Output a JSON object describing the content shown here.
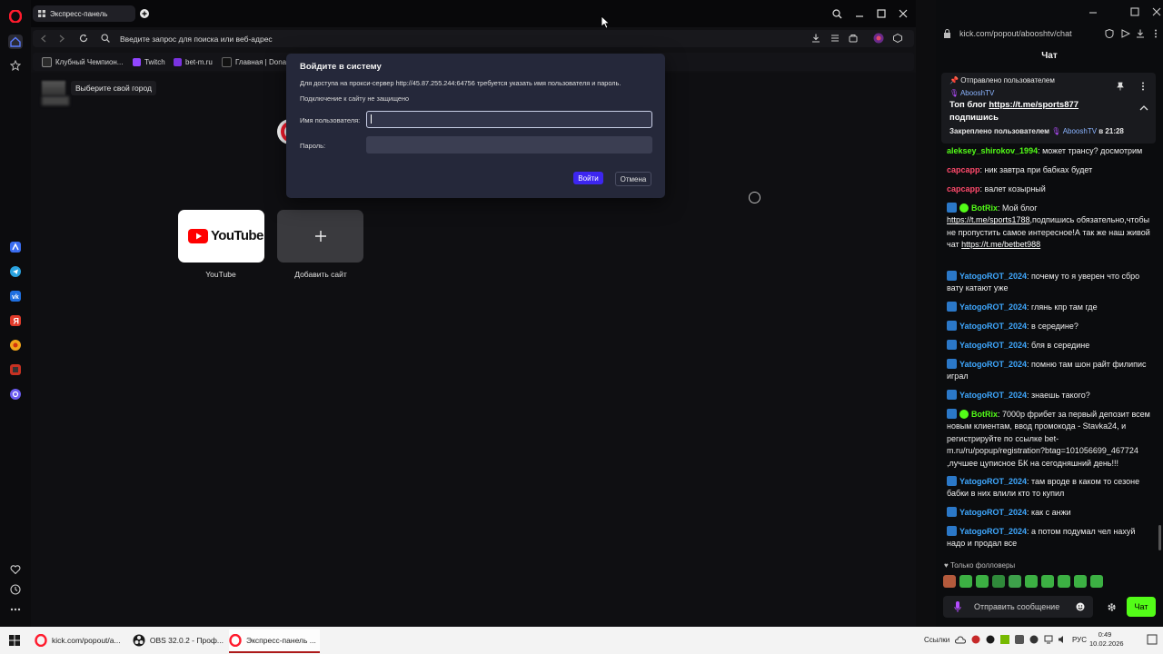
{
  "opera": {
    "tab_title": "Экспресс-панель",
    "address_placeholder": "Введите запрос для поиска или веб-адрес",
    "bookmarks": [
      {
        "label": "Клубный Чемпион..."
      },
      {
        "label": "Twitch"
      },
      {
        "label": "bet-m.ru"
      },
      {
        "label": "Главная | Donat"
      }
    ],
    "city_prompt": "Выберите свой город",
    "tiles": [
      {
        "label": "YouTube",
        "logo_text": "YouTube"
      },
      {
        "label": "Добавить сайт"
      }
    ],
    "colors": {
      "accent": "#ff1b2d",
      "dialog_bg": "#25283a",
      "login_btn": "#3d26f0"
    }
  },
  "dialog": {
    "title": "Войдите в систему",
    "message": "Для доступа на прокси-сервер http://45.87.255.244:64756 требуется указать имя пользователя и пароль.",
    "warning": "Подключение к сайту не защищено",
    "username_label": "Имя пользователя:",
    "username_value": "",
    "password_label": "Пароль:",
    "password_value": "",
    "login_button": "Войти",
    "cancel_button": "Отмена"
  },
  "kick": {
    "url": "kick.com/popout/aboosht​v/chat",
    "header_title": "Чат",
    "pinned": {
      "sent_by": "Отправлено пользователем",
      "author": "AbooshTV",
      "text_prefix": "Топ блог ",
      "link": "https://t.me/sports877",
      "text_suffix": "подпишись",
      "pinned_by_prefix": "Закреплено пользователем",
      "pinned_by_user": "AbooshTV",
      "pinned_time": "в 21:28"
    },
    "messages": [
      {
        "user": "aleksey_shirokov_1994",
        "color": "#53fc18",
        "text": ": может трансу? досмотрим",
        "badge": false,
        "bot": false
      },
      {
        "user": "capcapp",
        "color": "#ff4a6b",
        "text": ": ник завтра при бабках будет",
        "badge": false,
        "bot": false
      },
      {
        "user": "capcapp",
        "color": "#ff4a6b",
        "text": ": валет козырный",
        "badge": false,
        "bot": false
      },
      {
        "user": "BotRix",
        "color": "#53fc18",
        "text": ": Мой блог ",
        "link1": "https://t.me/sports1788",
        "text2": ",подпишись обязательно,чтобы не пропустить самое интересное!А так же наш живой чат ",
        "link2": "https://t.me/betbet988",
        "badge": true,
        "bot": true
      },
      {
        "user": "YatogoROT_2024",
        "color": "#3fa8ff",
        "text": ": почему то я уверен что сбро вату катают уже",
        "badge": true,
        "bot": false
      },
      {
        "user": "YatogoROT_2024",
        "color": "#3fa8ff",
        "text": ": глянь кпр там где",
        "badge": true,
        "bot": false
      },
      {
        "user": "YatogoROT_2024",
        "color": "#3fa8ff",
        "text": ": в середине?",
        "badge": true,
        "bot": false
      },
      {
        "user": "YatogoROT_2024",
        "color": "#3fa8ff",
        "text": ": бля в середине",
        "badge": true,
        "bot": false
      },
      {
        "user": "YatogoROT_2024",
        "color": "#3fa8ff",
        "text": ": помню там шон райт филипис играл",
        "badge": true,
        "bot": false
      },
      {
        "user": "YatogoROT_2024",
        "color": "#3fa8ff",
        "text": ": знаешь такого?",
        "badge": true,
        "bot": false
      },
      {
        "user": "BotRix",
        "color": "#53fc18",
        "text": ": 7000р фрибет за первый депозит всем новым клиентам, ввод промокода - Stavka24, и регистрируйте по ссылке bet-m.ru/ru/popup/registration?btag=101056699_467724 ,лучшее цуписное БК на сегодняшний день!!!",
        "badge": true,
        "bot": true
      },
      {
        "user": "YatogoROT_2024",
        "color": "#3fa8ff",
        "text": ": там вроде в каком то сезоне бабки в них влили кто то купил",
        "badge": true,
        "bot": false
      },
      {
        "user": "YatogoROT_2024",
        "color": "#3fa8ff",
        "text": ": как с анжи",
        "badge": true,
        "bot": false
      },
      {
        "user": "YatogoROT_2024",
        "color": "#3fa8ff",
        "text": ": а потом подумал чел нахуй надо и продал все",
        "badge": true,
        "bot": false
      }
    ],
    "followers_only": "Только фолловеры",
    "input_placeholder": "Отправить сообщение",
    "chat_button": "Чат",
    "colors": {
      "brand": "#53fc18"
    }
  },
  "taskbar": {
    "tasks": [
      {
        "label": "kick.com/popout/a..."
      },
      {
        "label": "OBS 32.0.2 - Проф..."
      },
      {
        "label": "Экспресс-панель ..."
      }
    ],
    "links_label": "Ссылки",
    "lang": "РУС",
    "time": "0:49",
    "date": "10.02.2026"
  }
}
